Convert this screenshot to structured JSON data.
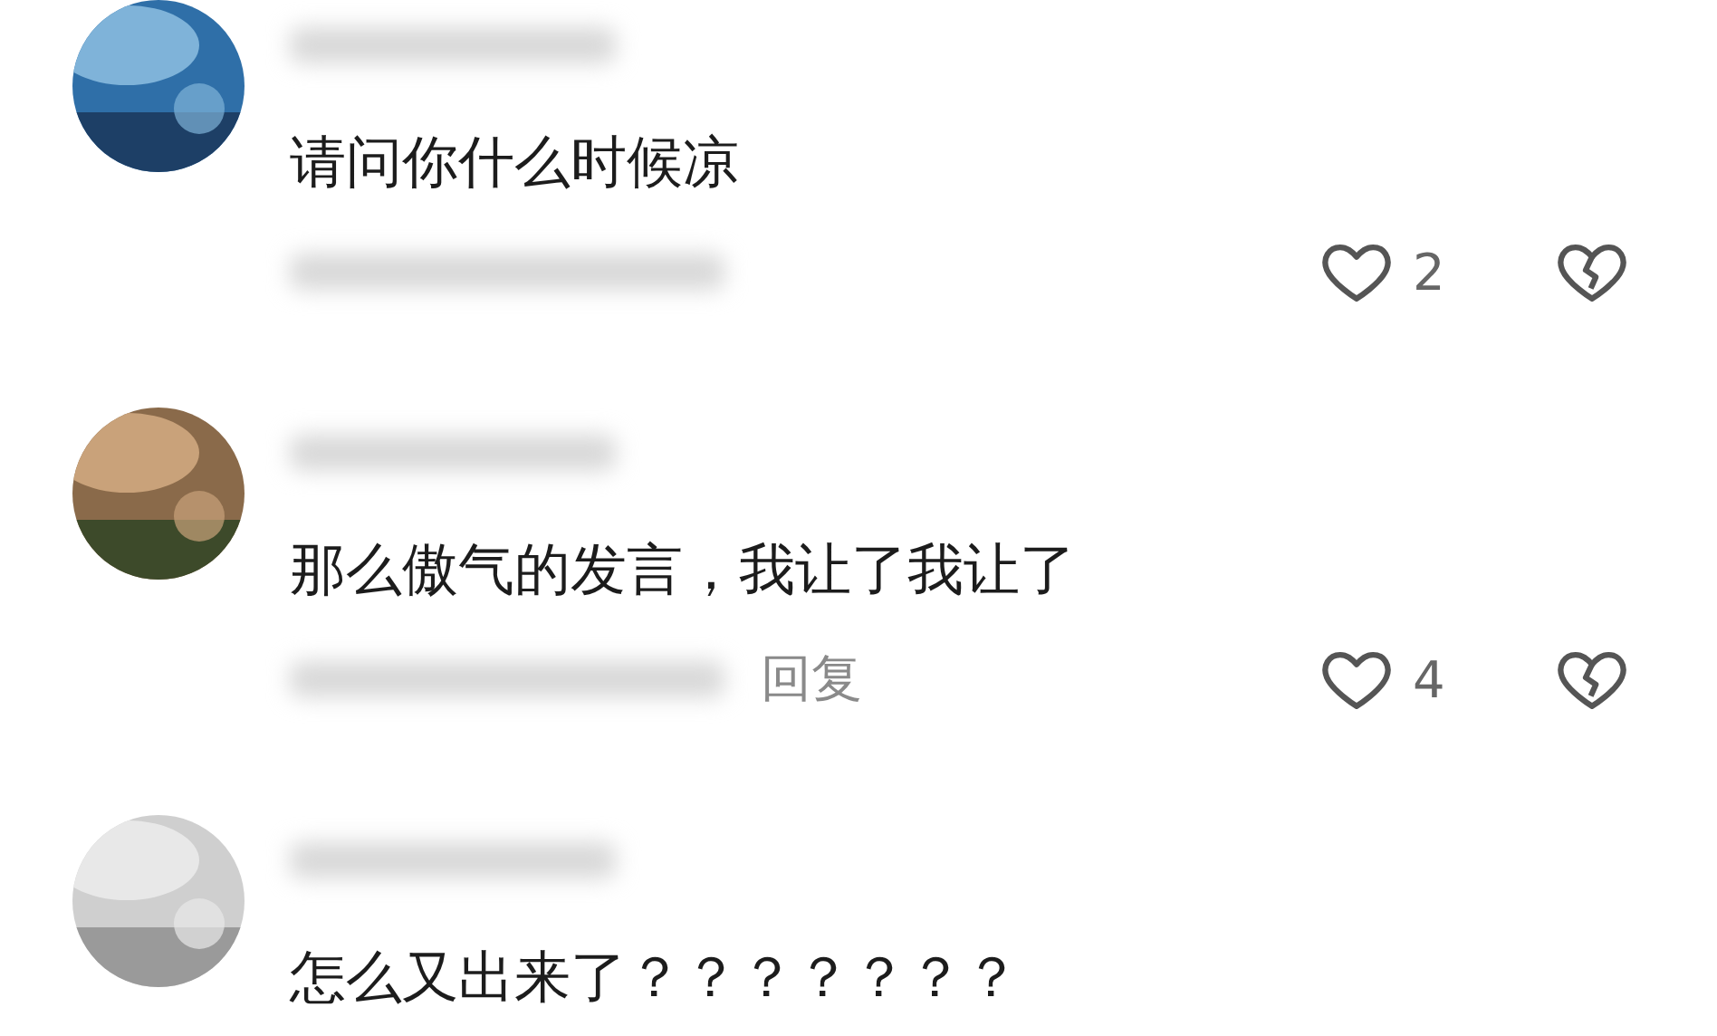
{
  "comments": [
    {
      "text": "请问你什么时候凉",
      "likes": "2"
    },
    {
      "text": "那么傲气的发言，我让了我让了",
      "reply_label": "回复",
      "likes": "4"
    },
    {
      "text": "怎么又出来了？？？？？？？"
    }
  ]
}
